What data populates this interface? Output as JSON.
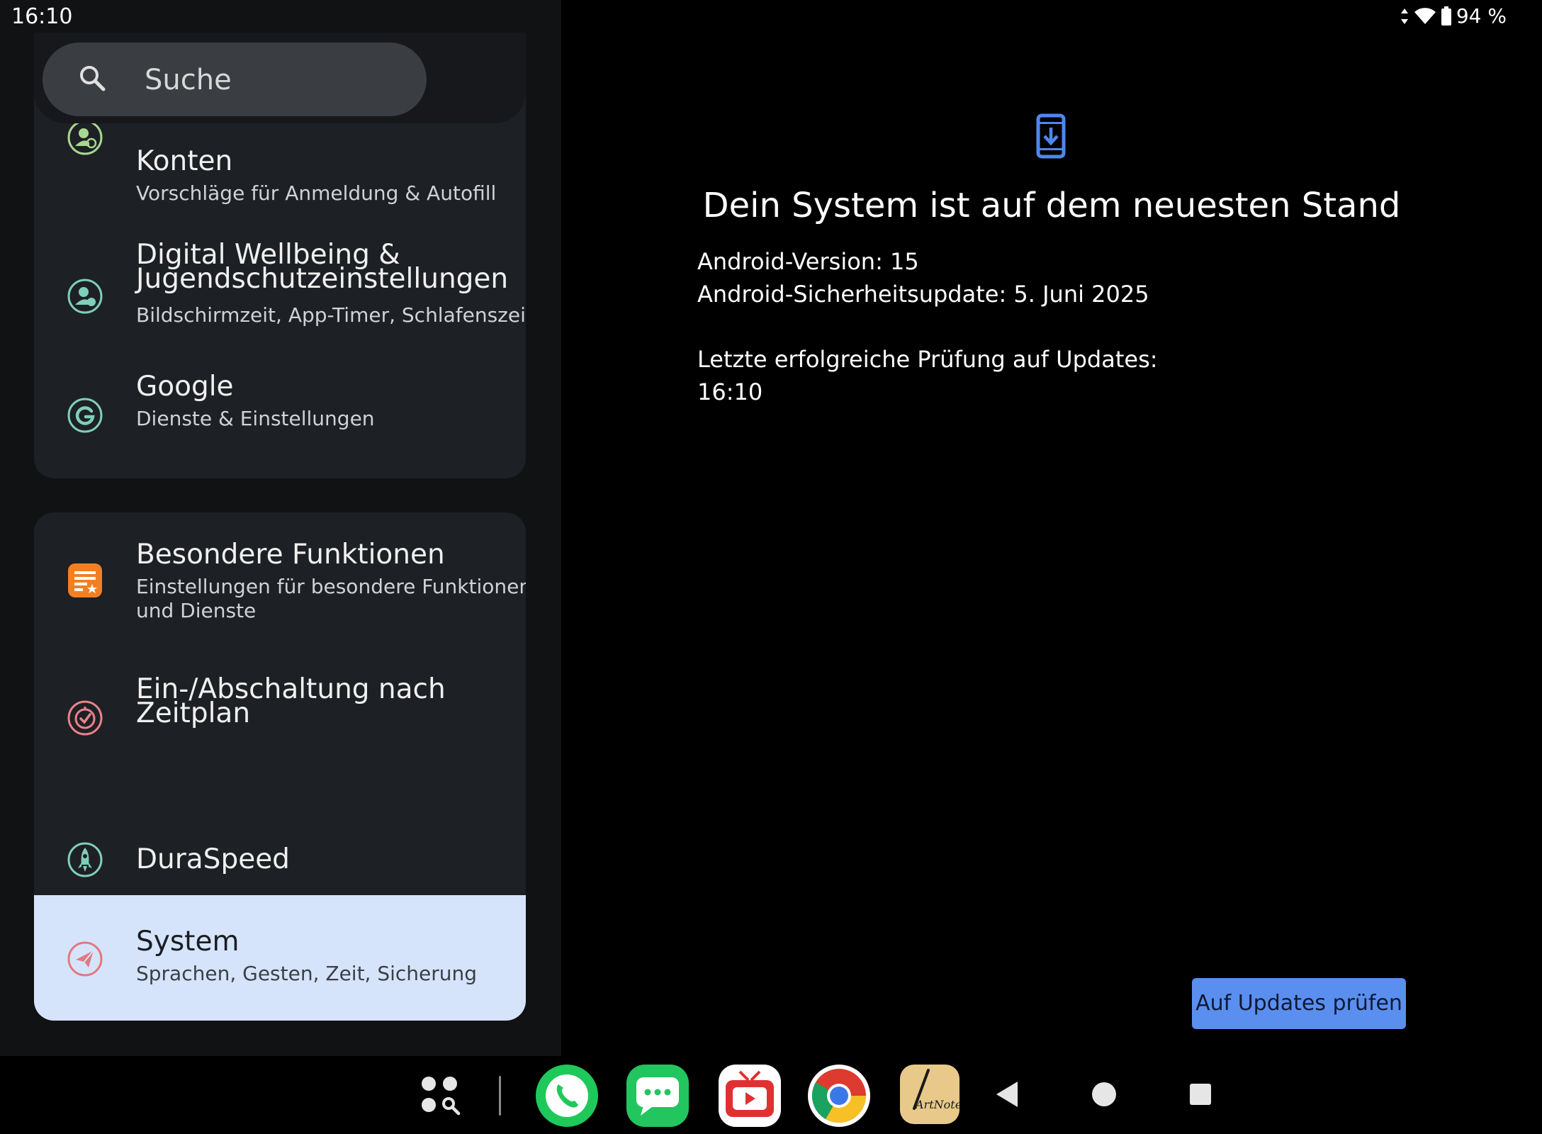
{
  "status_bar": {
    "time": "16:10",
    "battery": "94 %"
  },
  "search": {
    "placeholder": "Suche"
  },
  "settings_card1": [
    {
      "title": "Konten",
      "subtitle": "Vorschläge für Anmeldung & Autofill"
    },
    {
      "title_line1": "Digital Wellbeing &",
      "title_line2": "Jugendschutzeinstellungen",
      "subtitle": "Bildschirmzeit, App-Timer, Schlafenszeit"
    },
    {
      "title": "Google",
      "subtitle": "Dienste & Einstellungen"
    }
  ],
  "settings_card2": [
    {
      "title": "Besondere Funktionen",
      "subtitle_line1": "Einstellungen für besondere Funktionen",
      "subtitle_line2": "und Dienste"
    },
    {
      "title_line1": "Ein-/Abschaltung nach",
      "title_line2": "Zeitplan"
    },
    {
      "title": "DuraSpeed"
    },
    {
      "title": "System",
      "subtitle": "Sprachen, Gesten, Zeit, Sicherung"
    }
  ],
  "detail": {
    "headline": "Dein System ist auf dem neuesten Stand",
    "android_version": "Android-Version: 15",
    "security_update": "Android-Sicherheitsupdate: 5. Juni 2025",
    "last_check_label": "Letzte erfolgreiche Prüfung auf Updates:",
    "last_check_time": "16:10",
    "check_button": "Auf Updates prüfen"
  },
  "taskbar": {
    "apps": [
      "apps-drawer-icon",
      "phone-app-icon",
      "messages-app-icon",
      "tv-app-icon",
      "chrome-app-icon",
      "artnote-app-icon"
    ],
    "artnote_logo_text": "ArtNote",
    "nav": [
      "back-icon",
      "home-icon",
      "recents-icon"
    ]
  },
  "colors": {
    "selected_bg": "#d6e4fb",
    "accent_button": "#5a8ff0",
    "card_bg": "#1d2024"
  }
}
